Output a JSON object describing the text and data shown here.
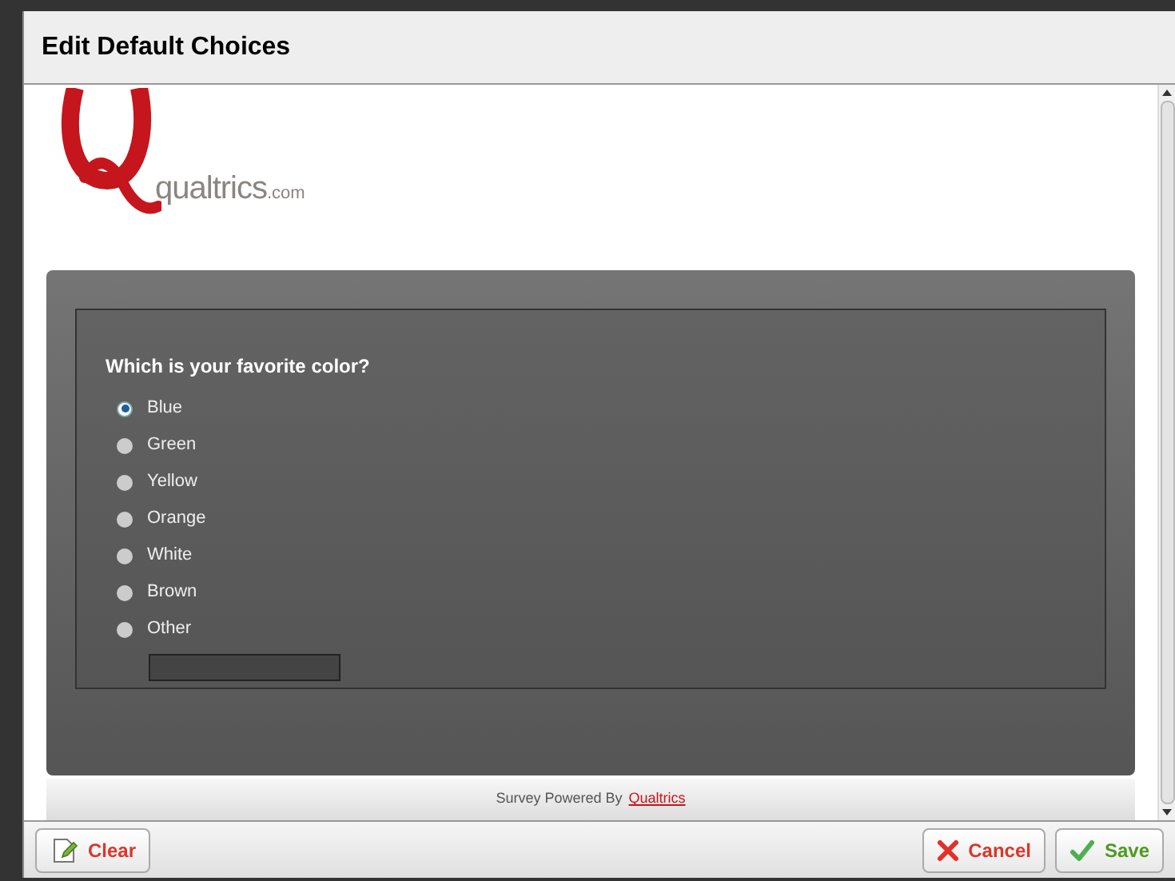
{
  "dialog": {
    "title": "Edit Default Choices"
  },
  "logo": {
    "text": "qualtrics",
    "suffix": ".com"
  },
  "question": {
    "text": "Which is your favorite color?",
    "choices": [
      {
        "label": "Blue",
        "selected": true
      },
      {
        "label": "Green",
        "selected": false
      },
      {
        "label": "Yellow",
        "selected": false
      },
      {
        "label": "Orange",
        "selected": false
      },
      {
        "label": "White",
        "selected": false
      },
      {
        "label": "Brown",
        "selected": false
      },
      {
        "label": "Other",
        "selected": false,
        "kind": "text-entry"
      }
    ]
  },
  "footer_note": {
    "text": "Survey Powered By",
    "link": "Qualtrics"
  },
  "buttons": [
    {
      "label": "Clear",
      "kind": "clear"
    },
    {
      "label": "Cancel",
      "kind": "cancel"
    },
    {
      "label": "Save",
      "kind": "save"
    }
  ]
}
